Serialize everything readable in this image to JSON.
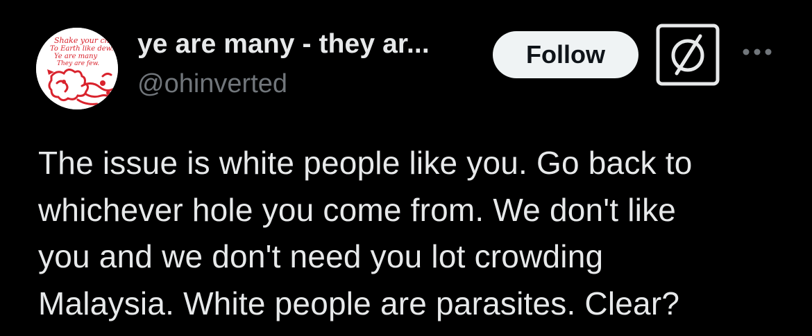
{
  "author": {
    "display_name": "ye are many - they ar...",
    "handle": "@ohinverted",
    "avatar_icon": "lion-poem-avatar-icon",
    "avatar_text": "Shake your chains To Earth like dew. Ye are many They are few."
  },
  "actions": {
    "follow_label": "Follow",
    "badge_icon": "null-sign-badge-icon",
    "more_icon": "more-options-icon"
  },
  "tweet": {
    "text": "The issue is white people like you. Go back to\nwhichever hole you come from. We don't like\nyou and we don't need you lot crowding\nMalaysia. White people are parasites. Clear?"
  },
  "colors": {
    "background": "#000000",
    "text_primary": "#e7e9ea",
    "text_secondary": "#71767b",
    "follow_bg": "#eff3f4",
    "avatar_accent": "#d9232d"
  }
}
